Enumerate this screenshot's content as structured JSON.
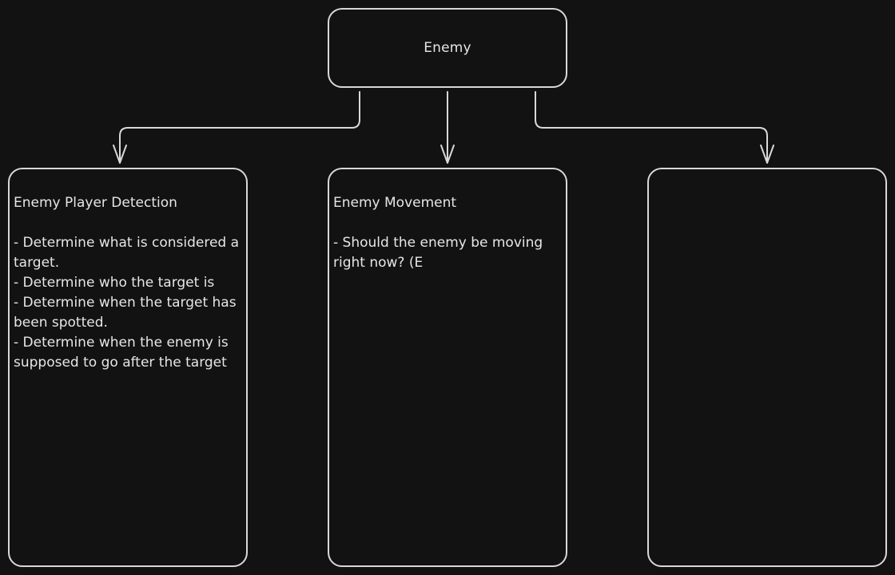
{
  "diagram": {
    "root": {
      "label": "Enemy"
    },
    "children": [
      {
        "title": "Enemy Player Detection",
        "lines": [
          "- Determine what is considered a target.",
          "- Determine who the target is",
          "- Determine when the target has been spotted.",
          "- Determine when the enemy is supposed to go after the target"
        ]
      },
      {
        "title": "Enemy Movement",
        "lines": [
          "- Should the enemy be moving right now? (E"
        ]
      },
      {
        "title": "",
        "lines": []
      }
    ]
  },
  "colors": {
    "background": "#121212",
    "stroke": "#d8d8d8",
    "text": "#e6e6e6"
  }
}
